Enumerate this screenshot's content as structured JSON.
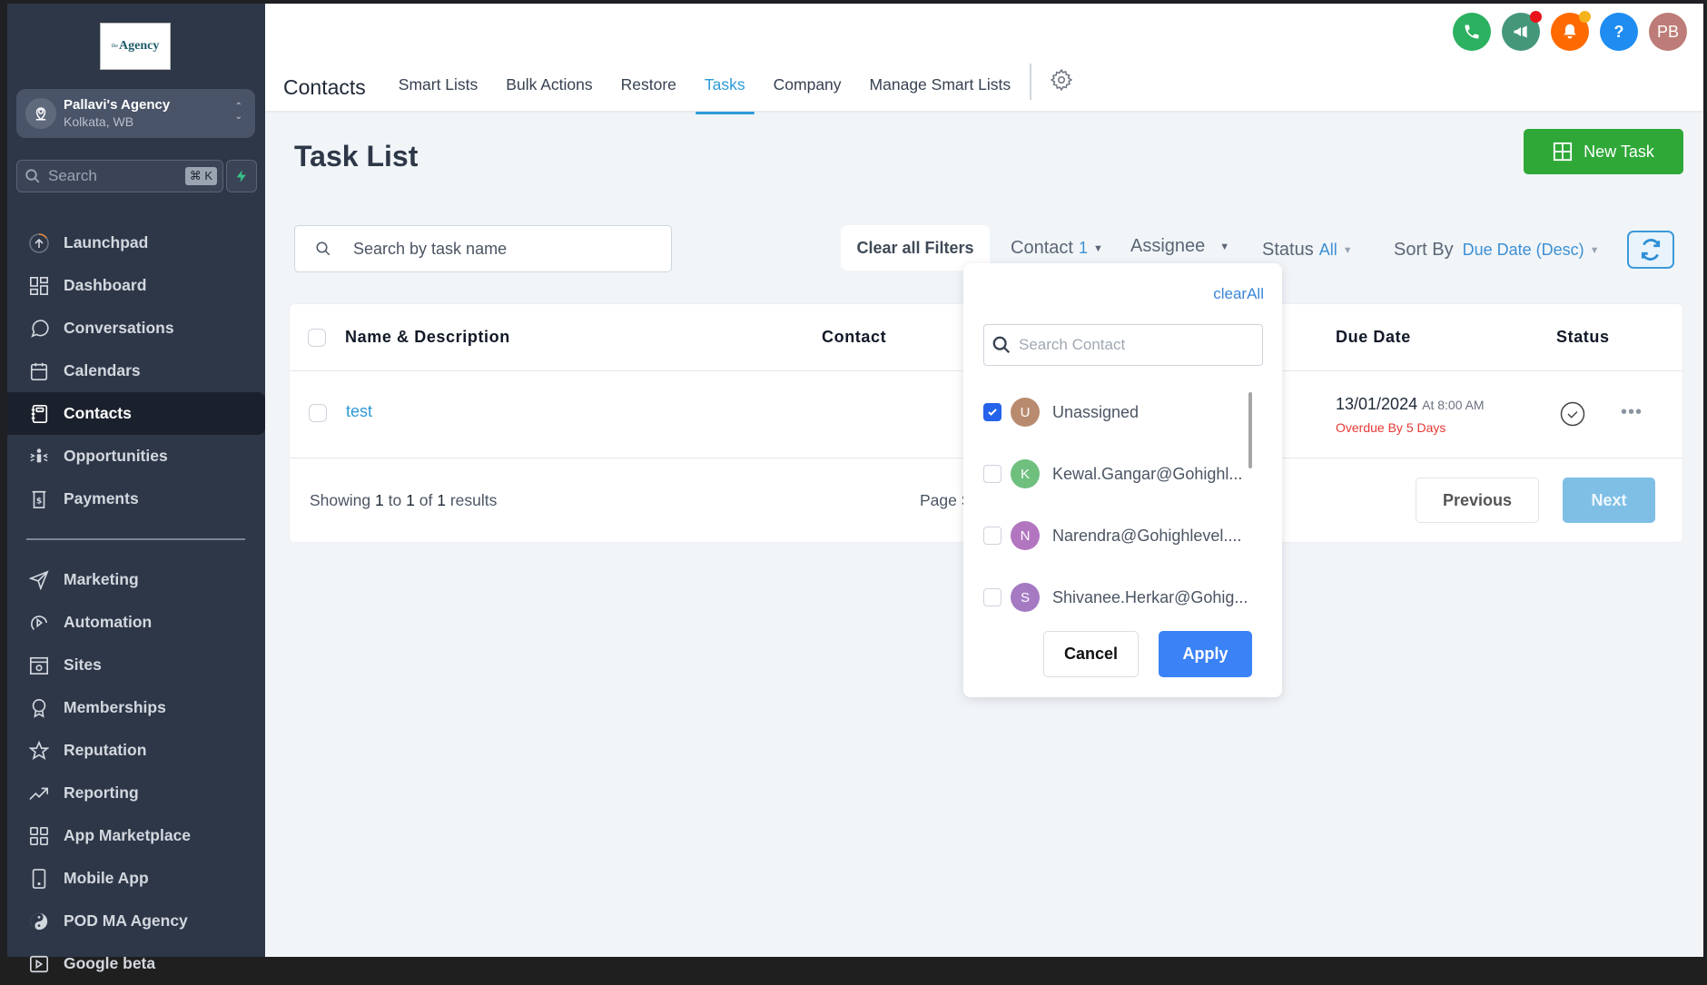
{
  "sidebar": {
    "logo_text": "Agency",
    "logo_prefix": "the",
    "account": {
      "name": "Pallavi's Agency",
      "location": "Kolkata, WB"
    },
    "search": {
      "placeholder": "Search",
      "shortcut": "⌘ K"
    },
    "items": [
      {
        "label": "Launchpad",
        "icon": "launchpad-icon"
      },
      {
        "label": "Dashboard",
        "icon": "dashboard-icon"
      },
      {
        "label": "Conversations",
        "icon": "chat-icon"
      },
      {
        "label": "Calendars",
        "icon": "calendar-icon"
      },
      {
        "label": "Contacts",
        "icon": "contacts-icon",
        "active": true
      },
      {
        "label": "Opportunities",
        "icon": "opportunities-icon"
      },
      {
        "label": "Payments",
        "icon": "payments-icon"
      }
    ],
    "items2": [
      {
        "label": "Marketing",
        "icon": "send-icon"
      },
      {
        "label": "Automation",
        "icon": "automation-icon"
      },
      {
        "label": "Sites",
        "icon": "sites-icon"
      },
      {
        "label": "Memberships",
        "icon": "award-icon"
      },
      {
        "label": "Reputation",
        "icon": "star-icon"
      },
      {
        "label": "Reporting",
        "icon": "trending-icon"
      },
      {
        "label": "App Marketplace",
        "icon": "grid-icon"
      },
      {
        "label": "Mobile App",
        "icon": "mobile-icon"
      },
      {
        "label": "POD MA Agency",
        "icon": "yin-yang-icon"
      },
      {
        "label": "Google beta",
        "icon": "video-icon"
      }
    ]
  },
  "topbar": {
    "section_title": "Contacts",
    "tabs": [
      "Smart Lists",
      "Bulk Actions",
      "Restore",
      "Tasks",
      "Company",
      "Manage Smart Lists"
    ],
    "active_tab": "Tasks",
    "avatar_initials": "PB",
    "colors": {
      "phone": "#2bb15f",
      "megaphone": "#45977a",
      "bell": "#ff6a00",
      "help": "#1e8cf0",
      "avatar": "#bd7c77"
    }
  },
  "page": {
    "title": "Task List",
    "new_task_label": "New Task",
    "search_placeholder": "Search by task name",
    "clear_filters_label": "Clear all Filters",
    "filters": {
      "contact_label": "Contact",
      "contact_count": "1",
      "assignee_label": "Assignee",
      "status_label": "Status",
      "status_value": "All",
      "sort_label": "Sort By",
      "sort_value": "Due Date (Desc)"
    }
  },
  "table": {
    "columns": [
      "Name & Description",
      "Contact",
      "Due Date",
      "Status"
    ],
    "rows": [
      {
        "name": "test",
        "due_date": "13/01/2024",
        "due_time": "At 8:00 AM",
        "overdue": "Overdue By 5 Days"
      }
    ],
    "footer": {
      "showing_prefix": "Showing",
      "from": "1",
      "to_word": "to",
      "to": "1",
      "of_word": "of",
      "total": "1",
      "suffix": "results",
      "page_partial": "Page S",
      "previous_label": "Previous",
      "next_label": "Next"
    }
  },
  "contact_dropdown": {
    "clear_all_label": "clearAll",
    "search_placeholder": "Search Contact",
    "options": [
      {
        "initial": "U",
        "label": "Unassigned",
        "checked": true,
        "color": "#b98b6e"
      },
      {
        "initial": "K",
        "label": "Kewal.Gangar@Gohighl...",
        "checked": false,
        "color": "#6fbf7f"
      },
      {
        "initial": "N",
        "label": "Narendra@Gohighlevel....",
        "checked": false,
        "color": "#b276c0"
      },
      {
        "initial": "S",
        "label": "Shivanee.Herkar@Gohig...",
        "checked": false,
        "color": "#a57ac2"
      }
    ],
    "cancel_label": "Cancel",
    "apply_label": "Apply"
  }
}
